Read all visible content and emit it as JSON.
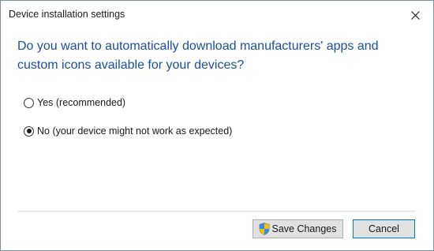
{
  "window": {
    "title": "Device installation settings"
  },
  "dialog": {
    "question": "Do you want to automatically download manufacturers' apps and custom icons available for your devices?",
    "options": [
      {
        "label": "Yes (recommended)",
        "selected": false
      },
      {
        "label": "No (your device might not work as expected)",
        "selected": true
      }
    ]
  },
  "buttons": {
    "save_label": "Save Changes",
    "cancel_label": "Cancel"
  },
  "icons": {
    "close": "close-icon",
    "shield": "uac-shield-icon"
  },
  "colors": {
    "question_text": "#1a4f9c",
    "window_border": "#7a8ea3",
    "default_button_border": "#0078d7"
  }
}
